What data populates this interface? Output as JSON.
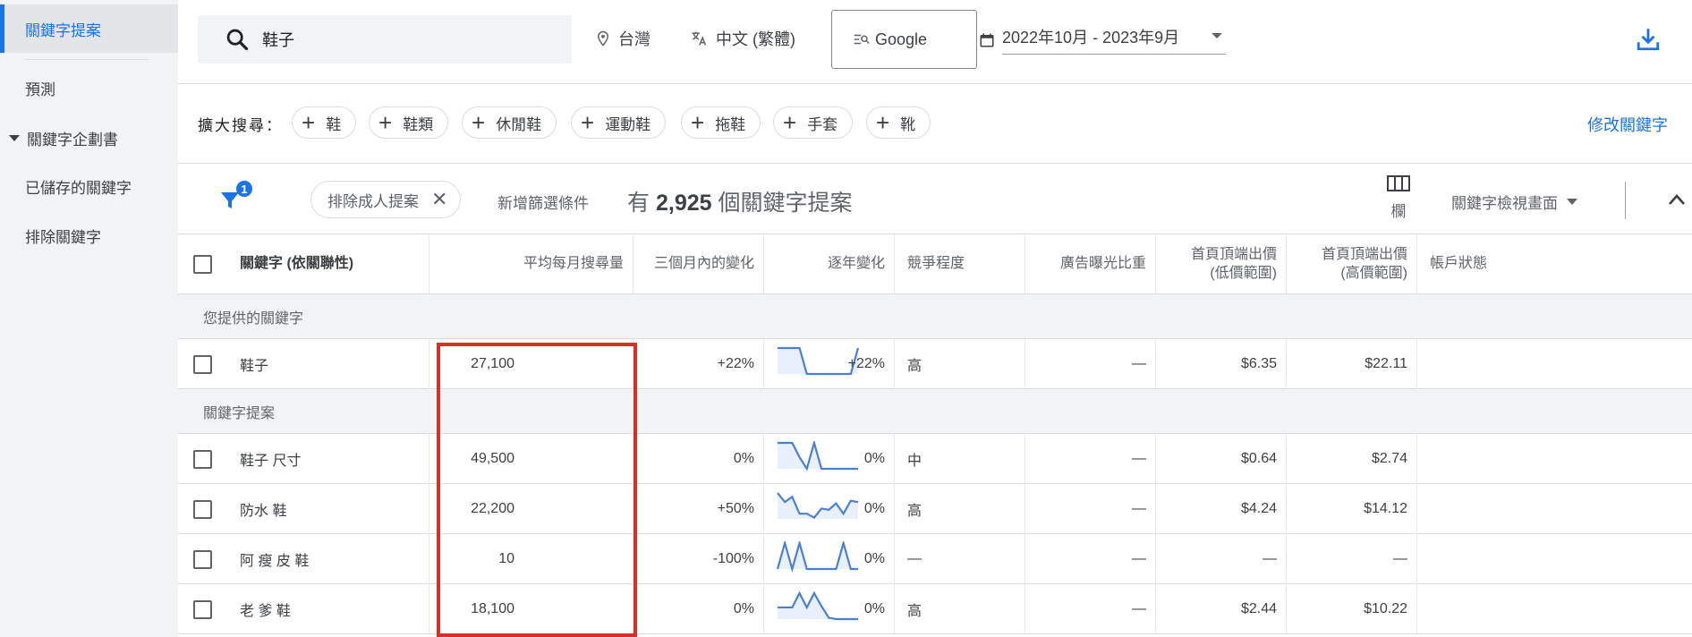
{
  "sidebar": {
    "items": [
      {
        "label": "關鍵字提案",
        "active": true
      },
      {
        "label": "預測"
      },
      {
        "label": "關鍵字企劃書"
      },
      {
        "label": "已儲存的關鍵字"
      },
      {
        "label": "排除關鍵字"
      }
    ]
  },
  "topbar": {
    "search_value": "鞋子",
    "location": "台灣",
    "language": "中文 (繁體)",
    "engine": "Google",
    "date_range": "2022年10月 - 2023年9月",
    "download_icon": "download-icon"
  },
  "expand": {
    "label": "擴大搜尋：",
    "chips": [
      "鞋",
      "鞋類",
      "休閒鞋",
      "運動鞋",
      "拖鞋",
      "手套",
      "靴"
    ],
    "modify_link": "修改關鍵字"
  },
  "filter": {
    "badge": "1",
    "chip_label": "排除成人提案",
    "add_filter": "新增篩選條件",
    "count_prefix": "有",
    "count_number": "2,925",
    "count_suffix": "個關鍵字提案",
    "columns_label": "欄",
    "view_label": "關鍵字檢視畫面"
  },
  "table": {
    "headers": {
      "keyword": "關鍵字 (依關聯性)",
      "avg_monthly": "平均每月搜尋量",
      "three_month": "三個月內的變化",
      "yoy": "逐年變化",
      "competition": "競爭程度",
      "impression_share": "廣告曝光比重",
      "bid_low_1": "首頁頂端出價",
      "bid_low_2": "(低價範圍)",
      "bid_high_1": "首頁頂端出價",
      "bid_high_2": "(高價範圍)",
      "account_status": "帳戶狀態"
    },
    "section_provided": "您提供的關鍵字",
    "section_ideas": "關鍵字提案",
    "provided_rows": [
      {
        "keyword": "鞋子",
        "volume": "27,100",
        "three_month": "+22%",
        "yoy": "+22%",
        "competition": "高",
        "impression": "—",
        "bid_low": "$6.35",
        "bid_high": "$22.11",
        "trend": [
          1,
          1,
          1,
          1,
          0,
          0,
          0,
          0,
          0,
          0,
          0,
          1
        ]
      }
    ],
    "idea_rows": [
      {
        "keyword": "鞋子 尺寸",
        "volume": "49,500",
        "three_month": "0%",
        "yoy": "0%",
        "competition": "中",
        "impression": "—",
        "bid_low": "$0.64",
        "bid_high": "$2.74",
        "trend": [
          1,
          1,
          1,
          0.45,
          0,
          1,
          0,
          0,
          0,
          0,
          0,
          0
        ]
      },
      {
        "keyword": "防水 鞋",
        "volume": "22,200",
        "three_month": "+50%",
        "yoy": "0%",
        "competition": "高",
        "impression": "—",
        "bid_low": "$4.24",
        "bid_high": "$14.12",
        "trend": [
          1,
          0.65,
          0.85,
          0.2,
          0.2,
          0.05,
          0.4,
          0.35,
          0.6,
          0.2,
          0.7,
          0.65
        ]
      },
      {
        "keyword": "阿 瘦 皮 鞋",
        "volume": "10",
        "three_month": "-100%",
        "yoy": "0%",
        "competition": "—",
        "impression": "—",
        "bid_low": "—",
        "bid_high": "—",
        "trend": [
          0,
          1,
          0,
          1,
          0,
          0,
          0,
          0,
          0,
          1,
          0,
          0
        ]
      },
      {
        "keyword": "老 爹 鞋",
        "volume": "18,100",
        "three_month": "0%",
        "yoy": "0%",
        "competition": "高",
        "impression": "—",
        "bid_low": "$2.44",
        "bid_high": "$10.22",
        "trend": [
          0.45,
          0.45,
          0.45,
          1,
          0.45,
          1,
          0.5,
          0.05,
          0,
          0,
          0,
          0
        ]
      }
    ]
  },
  "colors": {
    "accent": "#1a73e8",
    "sparkline": "#4a7fd4",
    "sparkfill": "#e8f0fe",
    "highlight": "#d93025"
  }
}
